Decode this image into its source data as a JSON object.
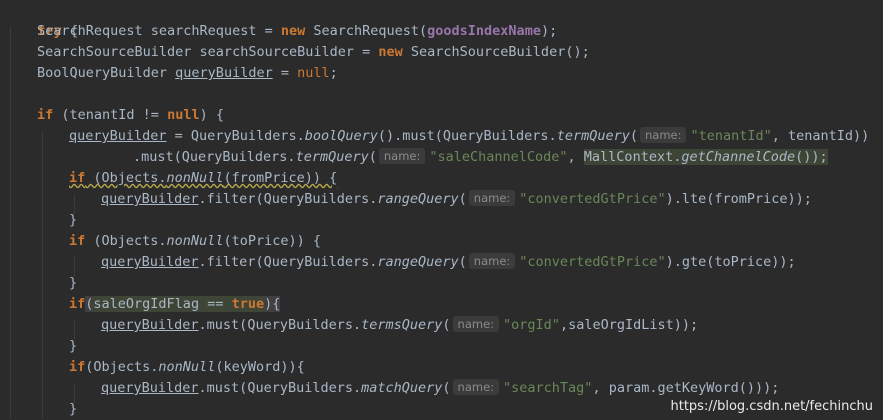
{
  "code": {
    "try": "try",
    "brace_open": "{",
    "brace_close": "}",
    "new": "new",
    "null": "null",
    "if": "if",
    "true": "true",
    "l1_type": "SearchRequest searchRequest = ",
    "l1_ctor": " SearchRequest(",
    "l1_field": "goodsIndexName",
    "l1_end": ");",
    "l2_type": "SearchSourceBuilder searchSourceBuilder = ",
    "l2_ctor": " SearchSourceBuilder();",
    "l3_type": "BoolQueryBuilder ",
    "var_qb": "queryBuilder",
    "l3_eq": " = ",
    "semi": ";",
    "l5_open": " (tenantId != ",
    "l5_close": ") {",
    "l6_mid": " = QueryBuilders.",
    "boolQuery": "boolQuery",
    "l6_mid2": "().must(QueryBuilders.",
    "termQuery": "termQuery",
    "paren": "(",
    "hint_name": "name:",
    "str_tenantId": "\"tenantId\"",
    "l6_end": ", tenantId))",
    "l7_start": ".must(QueryBuilders.",
    "str_saleChannelCode": "\"saleChannelCode\"",
    "comma": ", ",
    "mallctx": "MallContext.",
    "getChannelCode": "getChannelCode",
    "l7_end": "());",
    "objects": " (Objects.",
    "nonNull": "nonNull",
    "fromPrice": "(fromPrice)) {",
    "toPrice": "(toPrice)) {",
    "filter_start": ".filter(QueryBuilders.",
    "rangeQuery": "rangeQuery",
    "str_convertedGtPrice": "\"convertedGtPrice\"",
    "lte": ").lte(fromPrice));",
    "gte": ").gte(toPrice));",
    "if_paren": "(",
    "saleOrgIdFlag": "saleOrgIdFlag == ",
    "cond_end": "){",
    "must_start": ".must(QueryBuilders.",
    "termsQuery": "termsQuery",
    "str_orgId": "\"orgId\"",
    "l15_end": ",saleOrgIdList));",
    "objects2": "(Objects.",
    "keyWord": "(keyWord)){",
    "matchQuery": "matchQuery",
    "str_searchTag": "\"searchTag\"",
    "l18_end": ", param.getKeyWord()));"
  },
  "watermark": "https://blog.csdn.net/fechinchu"
}
